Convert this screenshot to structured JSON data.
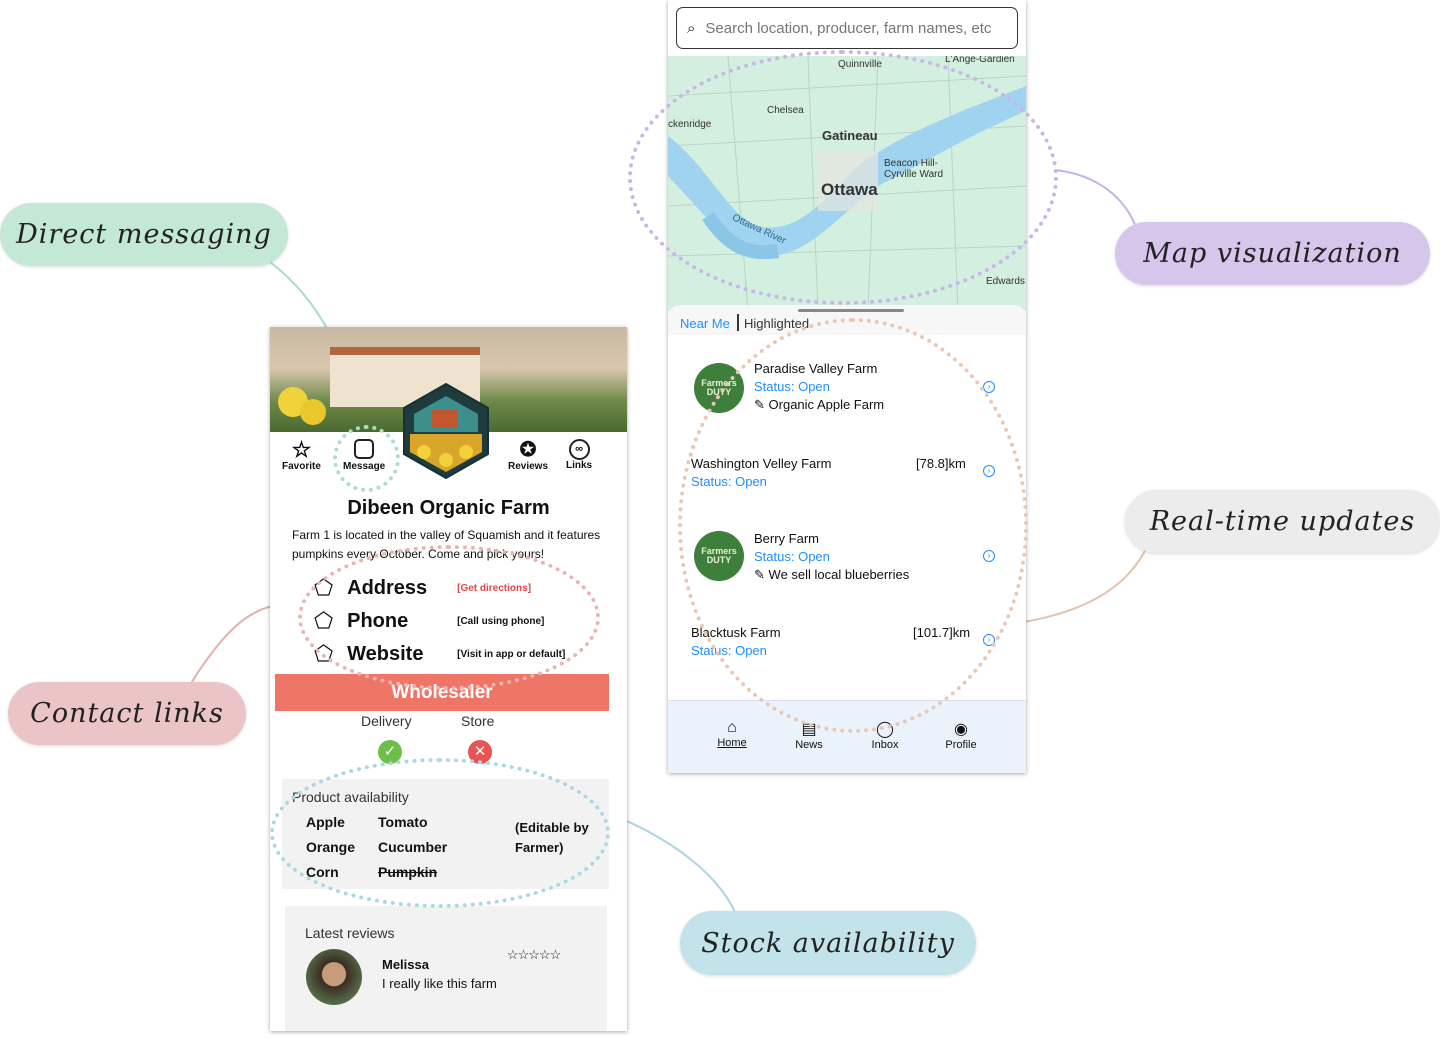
{
  "callouts": {
    "messaging": "Direct messaging",
    "map": "Map visualization",
    "realtime": "Real-time updates",
    "contact": "Contact links",
    "stock": "Stock availability"
  },
  "colors": {
    "messaging": "#c3e8d5",
    "map": "#d6c6ec",
    "realtime": "#ececec",
    "contact": "#ebc5c5",
    "stock": "#c3e3ea",
    "wholesaler": "#ef7566",
    "link_blue": "#1e90ff"
  },
  "farm_page": {
    "actions": [
      {
        "label": "Favorite",
        "icon": "star-icon"
      },
      {
        "label": "Message",
        "icon": "message-icon"
      },
      {
        "label": "Reviews",
        "icon": "award-icon"
      },
      {
        "label": "Links",
        "icon": "link-icon"
      }
    ],
    "name": "Dibeen Organic Farm",
    "description": "Farm 1 is located in the valley of Squamish and it features pumpkins every October. Come and pick yours!",
    "contacts": [
      {
        "label": "Address",
        "action": "[Get directions]"
      },
      {
        "label": "Phone",
        "action": "[Call using phone]"
      },
      {
        "label": "Website",
        "action": "[Visit in app or default]"
      }
    ],
    "wholesaler": "Wholesaler",
    "delivery": "Delivery",
    "store": "Store",
    "delivery_available": true,
    "store_available": false,
    "products_title": "Product availability",
    "products": [
      {
        "name": "Apple",
        "available": true
      },
      {
        "name": "Tomato",
        "available": true
      },
      {
        "name": "Orange",
        "available": true
      },
      {
        "name": "Cucumber",
        "available": true
      },
      {
        "name": "Corn",
        "available": true
      },
      {
        "name": "Pumpkin",
        "available": false
      }
    ],
    "editable_note": "(Editable by Farmer)",
    "reviews_title": "Latest reviews",
    "review": {
      "author": "Melissa",
      "text": "I really like this farm",
      "stars": "☆☆☆☆☆"
    }
  },
  "map_app": {
    "search_placeholder": "Search location, producer, farm names, etc",
    "map_labels": {
      "quinnville": "Quinnville",
      "lange": "L'Ange-Gardien",
      "chelsea": "Chelsea",
      "gatineau": "Gatineau",
      "ckenridge": "ckenridge",
      "ottawa": "Ottawa",
      "beacon": "Beacon Hill-Cyrville Ward",
      "river": "Ottawa River",
      "edwards": "Edwards"
    },
    "tabs": {
      "near_me": "Near Me",
      "highlighted": "Highlighted"
    },
    "farms": [
      {
        "name": "Paradise Valley Farm",
        "status": "Status: Open",
        "note": "Organic Apple Farm",
        "logo": "Farmers DUTY"
      },
      {
        "name": "Washington Velley Farm",
        "status": "Status: Open",
        "distance": "[78.8]km"
      },
      {
        "name": "Berry Farm",
        "status": "Status: Open",
        "note": "We sell local blueberries",
        "logo": "Farmers DUTY"
      },
      {
        "name": "Blacktusk Farm",
        "status": "Status: Open",
        "distance": "[101.7]km"
      }
    ],
    "nav": [
      {
        "label": "Home",
        "icon": "home-icon"
      },
      {
        "label": "News",
        "icon": "news-icon"
      },
      {
        "label": "Inbox",
        "icon": "chat-icon"
      },
      {
        "label": "Profile",
        "icon": "profile-icon"
      }
    ]
  }
}
